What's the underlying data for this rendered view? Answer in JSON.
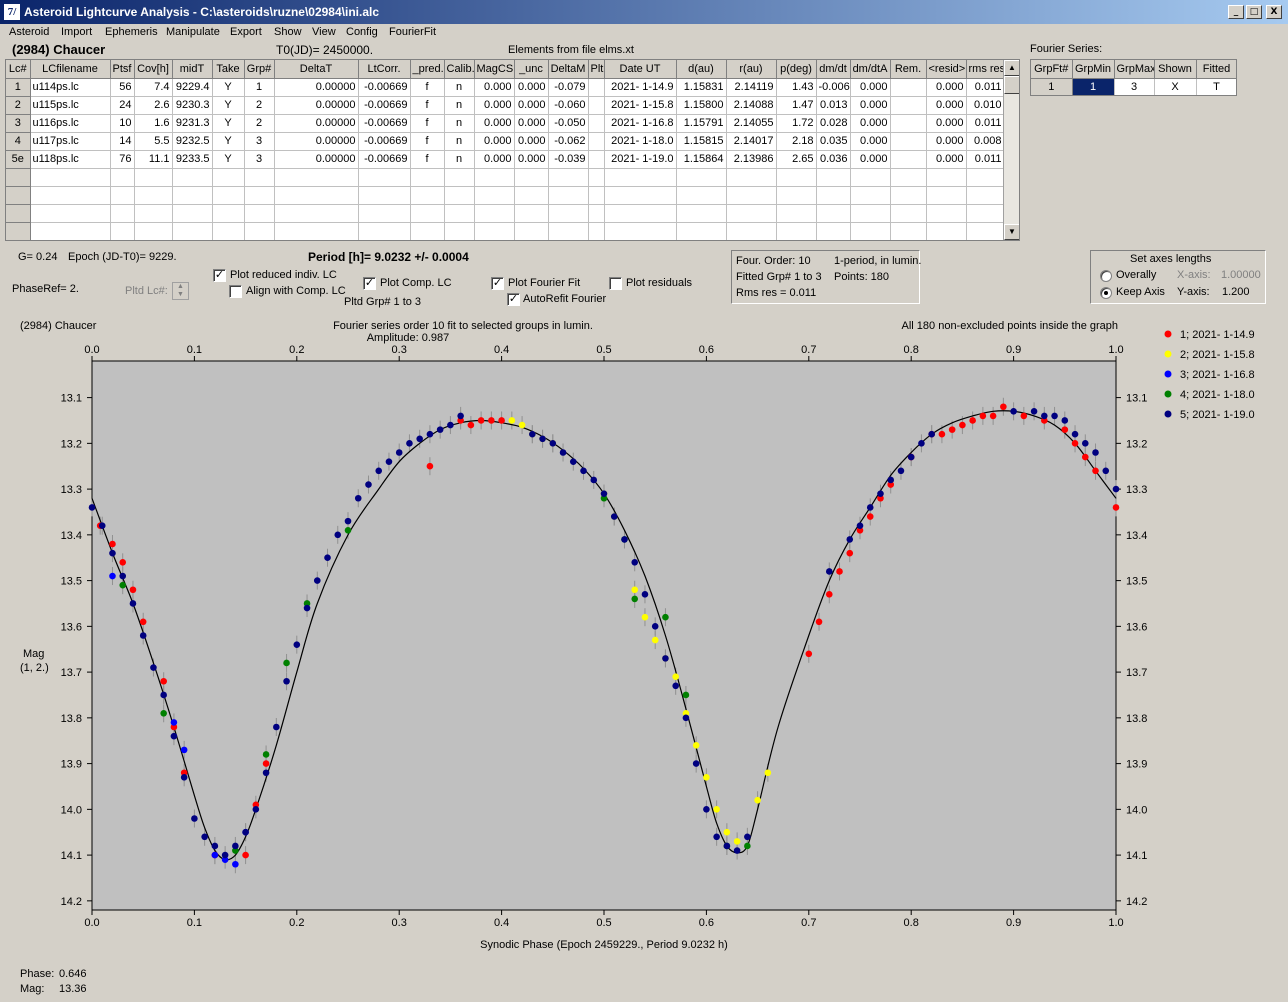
{
  "window": {
    "title": "Asteroid Lightcurve Analysis - C:\\asteroids\\ruzne\\02984\\ini.alc",
    "min": "_",
    "max": "□",
    "close": "X",
    "app_icon_label": "7/"
  },
  "menu": [
    "Asteroid",
    "Import",
    "Ephemeris",
    "Manipulate",
    "Export",
    "Show",
    "View",
    "Config",
    "FourierFit"
  ],
  "header": {
    "asteroid": "(2984) Chaucer",
    "t0": "T0(JD)= 2450000.",
    "elements": "Elements from file elms.xt",
    "fourier_series": "Fourier Series:"
  },
  "lc_table": {
    "columns": [
      "Lc#",
      "LCfilename",
      "Ptsf",
      "Cov[h]",
      "midT",
      "Take",
      "Grp#",
      "DeltaT",
      "LtCorr.",
      "_pred.",
      "Calib.",
      "MagCS",
      "_unc",
      "DeltaM",
      "Plt",
      "Date UT",
      "d(au)",
      "r(au)",
      "p(deg)",
      "dm/dt",
      "dm/dtA",
      "Rem.",
      "<resid>",
      "rms res"
    ],
    "rows": [
      [
        "1",
        "u114ps.lc",
        "56",
        "7.4",
        "9229.4",
        "Y",
        "1",
        "0.00000",
        "-0.00669",
        "f",
        "n",
        "0.000",
        "0.000",
        "-0.079",
        "",
        "2021- 1-14.9",
        "1.15831",
        "2.14119",
        "1.43",
        "-0.006",
        "0.000",
        "",
        "0.000",
        "0.011"
      ],
      [
        "2",
        "u115ps.lc",
        "24",
        "2.6",
        "9230.3",
        "Y",
        "2",
        "0.00000",
        "-0.00669",
        "f",
        "n",
        "0.000",
        "0.000",
        "-0.060",
        "",
        "2021- 1-15.8",
        "1.15800",
        "2.14088",
        "1.47",
        "0.013",
        "0.000",
        "",
        "0.000",
        "0.010"
      ],
      [
        "3",
        "u116ps.lc",
        "10",
        "1.6",
        "9231.3",
        "Y",
        "2",
        "0.00000",
        "-0.00669",
        "f",
        "n",
        "0.000",
        "0.000",
        "-0.050",
        "",
        "2021- 1-16.8",
        "1.15791",
        "2.14055",
        "1.72",
        "0.028",
        "0.000",
        "",
        "0.000",
        "0.011"
      ],
      [
        "4",
        "u117ps.lc",
        "14",
        "5.5",
        "9232.5",
        "Y",
        "3",
        "0.00000",
        "-0.00669",
        "f",
        "n",
        "0.000",
        "0.000",
        "-0.062",
        "",
        "2021- 1-18.0",
        "1.15815",
        "2.14017",
        "2.18",
        "0.035",
        "0.000",
        "",
        "0.000",
        "0.008"
      ],
      [
        "5e",
        "u118ps.lc",
        "76",
        "11.1",
        "9233.5",
        "Y",
        "3",
        "0.00000",
        "-0.00669",
        "f",
        "n",
        "0.000",
        "0.000",
        "-0.039",
        "",
        "2021- 1-19.0",
        "1.15864",
        "2.13986",
        "2.65",
        "0.036",
        "0.000",
        "",
        "0.000",
        "0.011"
      ]
    ],
    "empty_rows": 4
  },
  "fourier_table": {
    "columns": [
      "GrpFt#",
      "GrpMin",
      "GrpMax",
      "Shown",
      "Fitted"
    ],
    "row": [
      "1",
      "1",
      "3",
      "X",
      "T"
    ]
  },
  "info": {
    "g": "G= 0.24",
    "epoch": "Epoch (JD-T0)= 9229.",
    "period": "Period [h]= 9.0232 +/- 0.0004",
    "phaseref": "PhaseRef= 2.",
    "pltd_lc": "Pltd Lc#:",
    "pltd_grp": "Pltd Grp#  1   to   3"
  },
  "checks": {
    "plot_reduced": {
      "label": "Plot reduced indiv. LC",
      "checked": true
    },
    "align": {
      "label": "Align with Comp. LC",
      "checked": false
    },
    "plot_comp": {
      "label": "Plot Comp. LC",
      "checked": true
    },
    "plot_fourier": {
      "label": "Plot Fourier Fit",
      "checked": true
    },
    "autorefit": {
      "label": "AutoRefit Fourier",
      "checked": true
    },
    "plot_resid": {
      "label": "Plot residuals",
      "checked": false
    }
  },
  "fit_info": {
    "order": "Four. Order: 10",
    "period_mode": "1-period, in lumin.",
    "fitted": "Fitted Grp# 1 to 3",
    "points": "Points: 180",
    "rms": "Rms res      = 0.011"
  },
  "axes_box": {
    "title": "Set axes lengths",
    "overall": "Overally",
    "keep": "Keep Axis",
    "xlabel": "X-axis:",
    "xval": "1.00000",
    "ylabel": "Y-axis:",
    "yval": "1.200",
    "selected": "keep"
  },
  "status": {
    "phase_label": "Phase:",
    "phase": "0.646",
    "mag_label": "Mag:",
    "mag": "13.36"
  },
  "chart_data": {
    "type": "scatter",
    "title_left": "(2984) Chaucer",
    "title_center": "Fourier series order 10 fit to selected groups in lumin.",
    "amplitude": "Amplitude: 0.987",
    "title_right": "All 180 non-excluded points inside the graph",
    "xlabel": "Synodic Phase (Epoch 2459229., Period 9.0232 h)",
    "ylabel": "Mag",
    "ylabel2": "(1, 2.)",
    "xlim": [
      0,
      1
    ],
    "ylim": [
      13.02,
      14.22
    ],
    "y_inverted": true,
    "xticks": [
      "0.0",
      "0.1",
      "0.2",
      "0.3",
      "0.4",
      "0.5",
      "0.6",
      "0.7",
      "0.8",
      "0.9",
      "1.0"
    ],
    "yticks": [
      "13.1",
      "13.2",
      "13.3",
      "13.4",
      "13.5",
      "13.6",
      "13.7",
      "13.8",
      "13.9",
      "14.0",
      "14.1",
      "14.2"
    ],
    "background": "#c0c0c0",
    "fit_curve": {
      "x": [
        0,
        0.02,
        0.04,
        0.06,
        0.08,
        0.1,
        0.11,
        0.12,
        0.13,
        0.14,
        0.15,
        0.16,
        0.18,
        0.2,
        0.22,
        0.25,
        0.28,
        0.3,
        0.32,
        0.34,
        0.36,
        0.38,
        0.4,
        0.42,
        0.44,
        0.46,
        0.48,
        0.5,
        0.52,
        0.54,
        0.56,
        0.58,
        0.6,
        0.61,
        0.62,
        0.63,
        0.64,
        0.65,
        0.67,
        0.7,
        0.72,
        0.74,
        0.76,
        0.78,
        0.8,
        0.82,
        0.84,
        0.86,
        0.88,
        0.9,
        0.92,
        0.94,
        0.96,
        0.98,
        1.0
      ],
      "y": [
        13.32,
        13.44,
        13.55,
        13.68,
        13.82,
        13.97,
        14.04,
        14.09,
        14.11,
        14.1,
        14.06,
        14.0,
        13.86,
        13.7,
        13.55,
        13.4,
        13.3,
        13.24,
        13.2,
        13.17,
        13.155,
        13.15,
        13.155,
        13.165,
        13.185,
        13.215,
        13.255,
        13.31,
        13.39,
        13.49,
        13.62,
        13.78,
        13.95,
        14.03,
        14.08,
        14.095,
        14.08,
        14.0,
        13.82,
        13.62,
        13.5,
        13.41,
        13.34,
        13.27,
        13.22,
        13.18,
        13.155,
        13.14,
        13.13,
        13.13,
        13.14,
        13.16,
        13.2,
        13.26,
        13.32
      ]
    },
    "series": [
      {
        "name": "1; 2021- 1-14.9",
        "color": "#ff0000",
        "x": [
          0.008,
          0.02,
          0.03,
          0.04,
          0.05,
          0.07,
          0.08,
          0.09,
          0.12,
          0.15,
          0.16,
          0.17,
          0.33,
          0.36,
          0.37,
          0.38,
          0.39,
          0.4,
          0.7,
          0.71,
          0.72,
          0.73,
          0.74,
          0.75,
          0.76,
          0.77,
          0.78,
          0.8,
          0.82,
          0.83,
          0.84,
          0.85,
          0.86,
          0.87,
          0.88,
          0.89,
          0.91,
          0.93,
          0.95,
          0.96,
          0.97,
          0.98,
          1.0
        ],
        "y": [
          13.38,
          13.42,
          13.46,
          13.52,
          13.59,
          13.72,
          13.82,
          13.92,
          14.1,
          14.1,
          13.99,
          13.9,
          13.25,
          13.15,
          13.16,
          13.15,
          13.15,
          13.15,
          13.66,
          13.59,
          13.53,
          13.48,
          13.44,
          13.39,
          13.36,
          13.32,
          13.29,
          13.23,
          13.18,
          13.18,
          13.17,
          13.16,
          13.15,
          13.14,
          13.14,
          13.12,
          13.14,
          13.15,
          13.17,
          13.2,
          13.23,
          13.26,
          13.34
        ]
      },
      {
        "name": "2; 2021- 1-15.8",
        "color": "#ffff00",
        "x": [
          0.41,
          0.42,
          0.43,
          0.44,
          0.45,
          0.5,
          0.51,
          0.53,
          0.54,
          0.55,
          0.56,
          0.57,
          0.58,
          0.59,
          0.6,
          0.61,
          0.62,
          0.63,
          0.65,
          0.66
        ],
        "y": [
          13.15,
          13.16,
          13.18,
          13.19,
          13.2,
          13.31,
          13.36,
          13.52,
          13.58,
          13.63,
          13.67,
          13.71,
          13.79,
          13.86,
          13.93,
          14.0,
          14.05,
          14.07,
          13.98,
          13.92
        ]
      },
      {
        "name": "3; 2021- 1-16.8",
        "color": "#0000ff",
        "x": [
          0.02,
          0.08,
          0.09,
          0.12,
          0.13,
          0.14,
          0.15
        ],
        "y": [
          13.49,
          13.81,
          13.87,
          14.1,
          14.11,
          14.12,
          14.05
        ]
      },
      {
        "name": "4; 2021- 1-18.0",
        "color": "#008000",
        "x": [
          0.03,
          0.07,
          0.14,
          0.17,
          0.19,
          0.21,
          0.25,
          0.5,
          0.52,
          0.53,
          0.56,
          0.58,
          0.62,
          0.64
        ],
        "y": [
          13.51,
          13.79,
          14.09,
          13.88,
          13.68,
          13.55,
          13.39,
          13.32,
          13.41,
          13.54,
          13.58,
          13.75,
          14.08,
          14.08
        ]
      },
      {
        "name": "5; 2021- 1-19.0",
        "color": "#000080",
        "x": [
          0.0,
          0.01,
          0.02,
          0.03,
          0.04,
          0.05,
          0.06,
          0.07,
          0.08,
          0.09,
          0.1,
          0.11,
          0.12,
          0.13,
          0.14,
          0.15,
          0.16,
          0.17,
          0.18,
          0.19,
          0.2,
          0.21,
          0.22,
          0.23,
          0.24,
          0.25,
          0.26,
          0.27,
          0.28,
          0.29,
          0.3,
          0.31,
          0.32,
          0.33,
          0.34,
          0.35,
          0.36,
          0.43,
          0.44,
          0.45,
          0.46,
          0.47,
          0.48,
          0.49,
          0.5,
          0.51,
          0.52,
          0.53,
          0.54,
          0.55,
          0.56,
          0.57,
          0.58,
          0.59,
          0.6,
          0.61,
          0.62,
          0.63,
          0.64,
          0.72,
          0.74,
          0.75,
          0.76,
          0.77,
          0.78,
          0.79,
          0.8,
          0.81,
          0.82,
          0.9,
          0.92,
          0.93,
          0.94,
          0.95,
          0.96,
          0.97,
          0.98,
          0.99,
          1.0
        ],
        "y": [
          13.34,
          13.38,
          13.44,
          13.49,
          13.55,
          13.62,
          13.69,
          13.75,
          13.84,
          13.93,
          14.02,
          14.06,
          14.08,
          14.1,
          14.08,
          14.05,
          14.0,
          13.92,
          13.82,
          13.72,
          13.64,
          13.56,
          13.5,
          13.45,
          13.4,
          13.37,
          13.32,
          13.29,
          13.26,
          13.24,
          13.22,
          13.2,
          13.19,
          13.18,
          13.17,
          13.16,
          13.14,
          13.18,
          13.19,
          13.2,
          13.22,
          13.24,
          13.26,
          13.28,
          13.31,
          13.36,
          13.41,
          13.46,
          13.53,
          13.6,
          13.67,
          13.73,
          13.8,
          13.9,
          14.0,
          14.06,
          14.08,
          14.09,
          14.06,
          13.48,
          13.41,
          13.38,
          13.34,
          13.31,
          13.28,
          13.26,
          13.23,
          13.2,
          13.18,
          13.13,
          13.13,
          13.14,
          13.14,
          13.15,
          13.18,
          13.2,
          13.22,
          13.26,
          13.3
        ]
      }
    ]
  }
}
